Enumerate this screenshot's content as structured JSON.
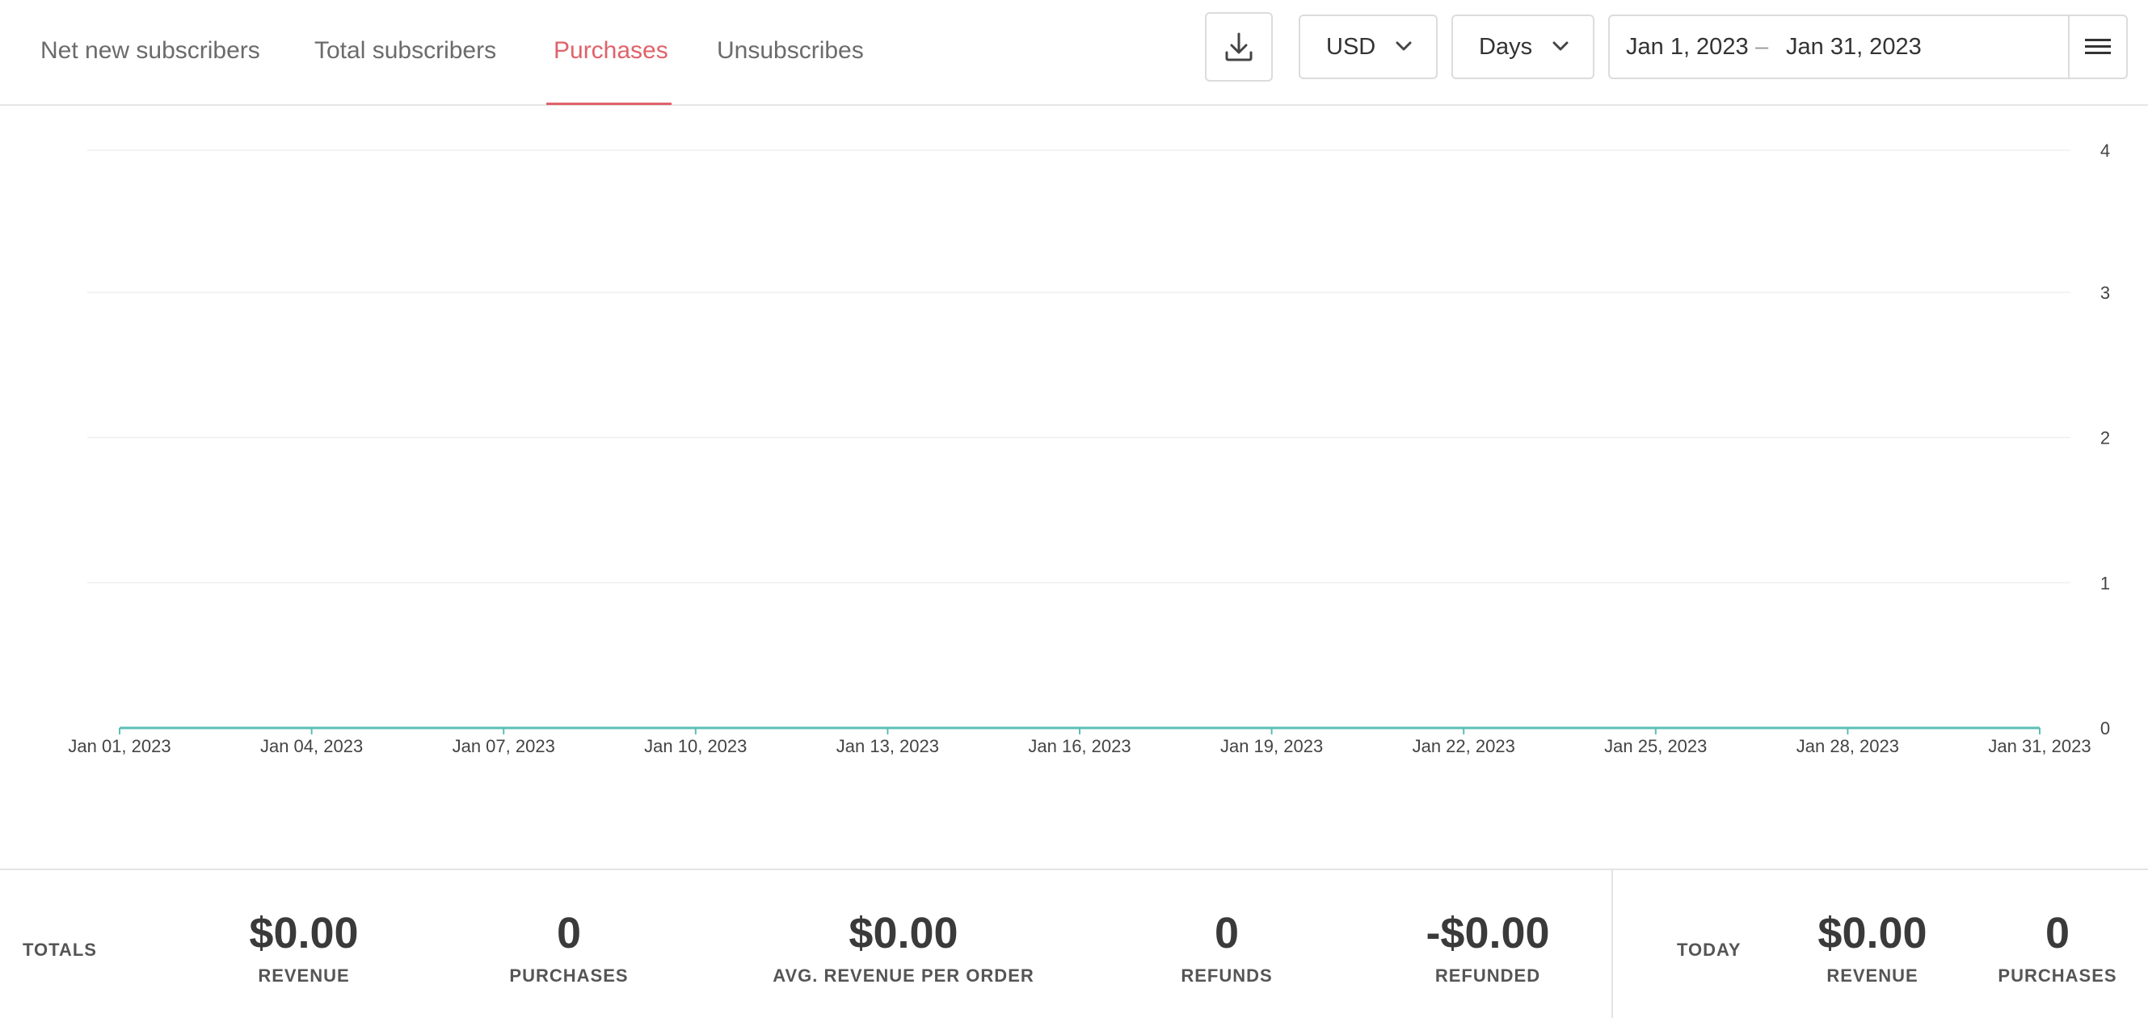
{
  "tabs": [
    {
      "label": "Net new subscribers",
      "active": false
    },
    {
      "label": "Total subscribers",
      "active": false
    },
    {
      "label": "Purchases",
      "active": true
    },
    {
      "label": "Unsubscribes",
      "active": false
    }
  ],
  "toolbar": {
    "download_icon": "download-icon",
    "currency": "USD",
    "interval": "Days",
    "date_start": "Jan 1, 2023",
    "date_separator": "–",
    "date_end": "Jan 31, 2023",
    "menu_icon": "hamburger-icon"
  },
  "colors": {
    "accent": "#e0626a",
    "series": "#5bbfb5"
  },
  "chart_data": {
    "type": "line",
    "x": [
      "Jan 01, 2023",
      "Jan 02, 2023",
      "Jan 03, 2023",
      "Jan 04, 2023",
      "Jan 05, 2023",
      "Jan 06, 2023",
      "Jan 07, 2023",
      "Jan 08, 2023",
      "Jan 09, 2023",
      "Jan 10, 2023",
      "Jan 11, 2023",
      "Jan 12, 2023",
      "Jan 13, 2023",
      "Jan 14, 2023",
      "Jan 15, 2023",
      "Jan 16, 2023",
      "Jan 17, 2023",
      "Jan 18, 2023",
      "Jan 19, 2023",
      "Jan 20, 2023",
      "Jan 21, 2023",
      "Jan 22, 2023",
      "Jan 23, 2023",
      "Jan 24, 2023",
      "Jan 25, 2023",
      "Jan 26, 2023",
      "Jan 27, 2023",
      "Jan 28, 2023",
      "Jan 29, 2023",
      "Jan 30, 2023",
      "Jan 31, 2023"
    ],
    "series": [
      {
        "values": [
          0,
          0,
          0,
          0,
          0,
          0,
          0,
          0,
          0,
          0,
          0,
          0,
          0,
          0,
          0,
          0,
          0,
          0,
          0,
          0,
          0,
          0,
          0,
          0,
          0,
          0,
          0,
          0,
          0,
          0,
          0
        ]
      }
    ],
    "x_tick_labels": [
      "Jan 01, 2023",
      "Jan 04, 2023",
      "Jan 07, 2023",
      "Jan 10, 2023",
      "Jan 13, 2023",
      "Jan 16, 2023",
      "Jan 19, 2023",
      "Jan 22, 2023",
      "Jan 25, 2023",
      "Jan 28, 2023",
      "Jan 31, 2023"
    ],
    "y_ticks": [
      0,
      1,
      2,
      3,
      4
    ],
    "ylim": [
      0,
      4
    ],
    "y_axis_side": "right",
    "grid": true
  },
  "totals": {
    "label": "TOTALS",
    "items": [
      {
        "value": "$0.00",
        "caption": "REVENUE"
      },
      {
        "value": "0",
        "caption": "PURCHASES"
      },
      {
        "value": "$0.00",
        "caption": "AVG. REVENUE PER ORDER"
      },
      {
        "value": "0",
        "caption": "REFUNDS"
      },
      {
        "value": "-$0.00",
        "caption": "REFUNDED"
      }
    ]
  },
  "today": {
    "label": "TODAY",
    "items": [
      {
        "value": "$0.00",
        "caption": "REVENUE"
      },
      {
        "value": "0",
        "caption": "PURCHASES"
      }
    ]
  }
}
